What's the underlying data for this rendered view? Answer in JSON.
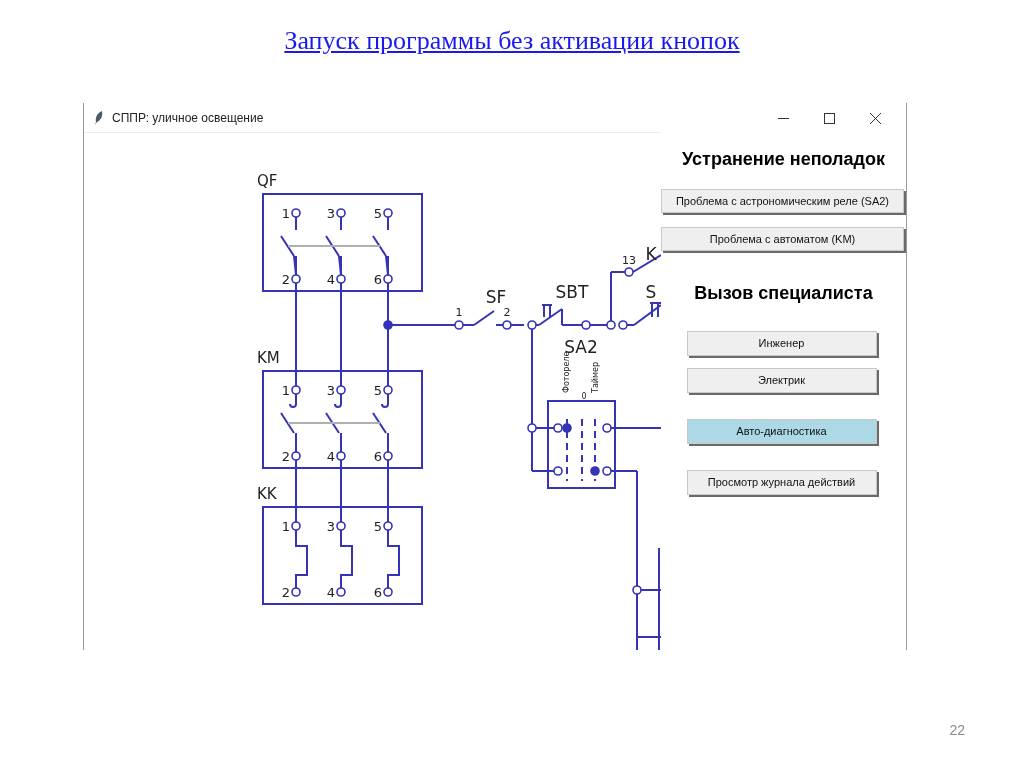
{
  "slide": {
    "title": "Запуск программы без активации кнопок",
    "page_number": "22"
  },
  "window": {
    "title": "СППР: уличное освещение"
  },
  "diagram": {
    "blocks": [
      {
        "label": "QF",
        "kind": "breaker",
        "terminals": [
          "1",
          "3",
          "5",
          "2",
          "4",
          "6"
        ]
      },
      {
        "label": "KM",
        "kind": "contactor",
        "terminals": [
          "1",
          "3",
          "5",
          "2",
          "4",
          "6"
        ]
      },
      {
        "label": "KK",
        "kind": "thermal",
        "terminals": [
          "1",
          "3",
          "5",
          "2",
          "4",
          "6"
        ]
      }
    ],
    "line_labels": [
      "SF",
      "1",
      "2",
      "SBT",
      "13",
      "K",
      "S"
    ],
    "switch": {
      "label": "SA2",
      "positions": [
        "Фотореле",
        "0",
        "Таймер"
      ]
    }
  },
  "panel": {
    "sections": [
      {
        "heading": "Устранение неполадок",
        "buttons": [
          {
            "label": "Проблема с астрономическим реле (SA2)",
            "highlighted": false
          },
          {
            "label": "Проблема с автоматом (KM)",
            "highlighted": false
          }
        ]
      },
      {
        "heading": "Вызов специалиста",
        "buttons": [
          {
            "label": "Инженер",
            "highlighted": false
          },
          {
            "label": "Электрик",
            "highlighted": false
          },
          {
            "label": "Авто-диагностика",
            "highlighted": true
          },
          {
            "label": "Просмотр журнала действий",
            "highlighted": false
          }
        ]
      }
    ]
  }
}
